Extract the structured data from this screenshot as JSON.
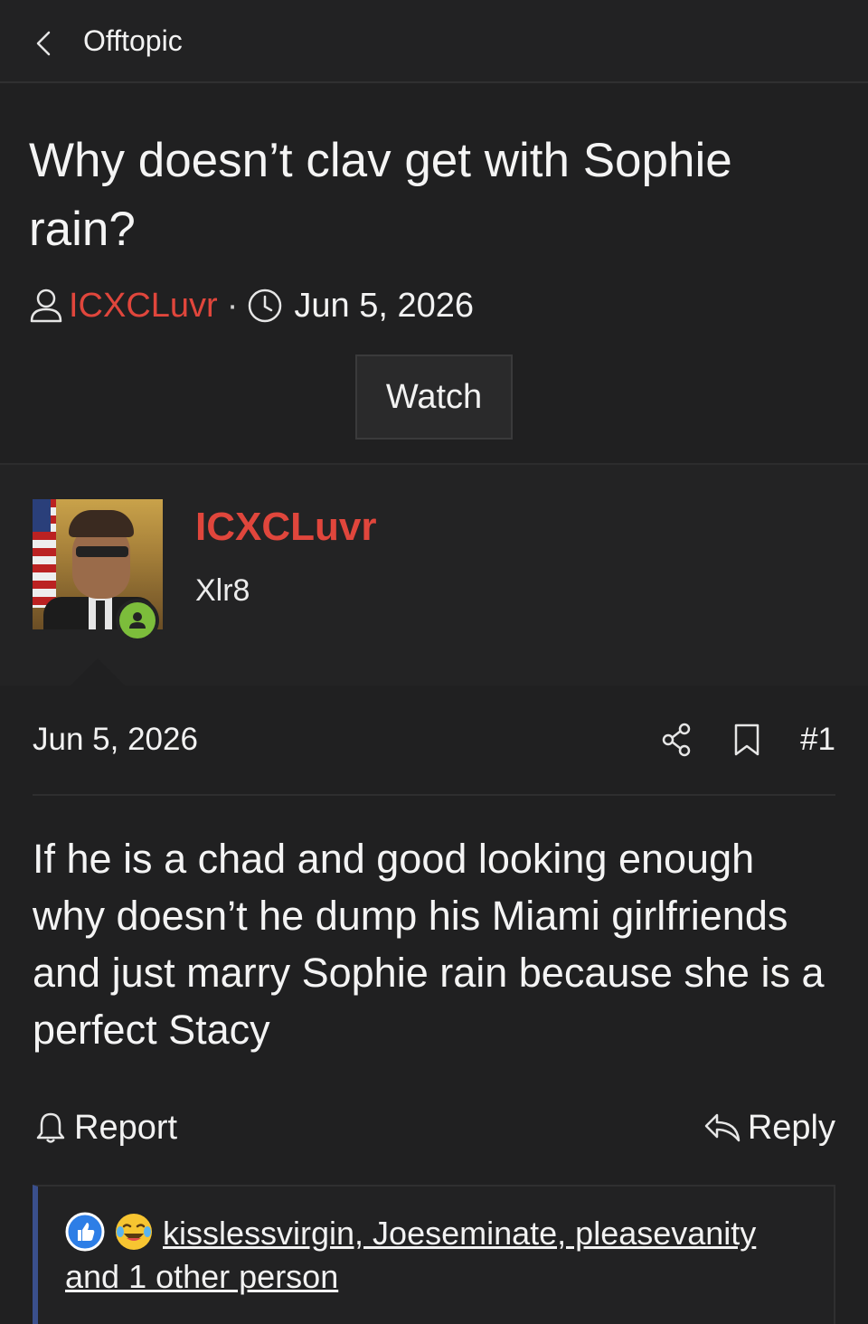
{
  "nav": {
    "forum_name": "Offtopic"
  },
  "thread": {
    "title": "Why doesn’t clav get with Sophie rain?",
    "author": "ICXCLuvr",
    "separator": "·",
    "date": "Jun 5, 2026",
    "watch_label": "Watch"
  },
  "post": {
    "username": "ICXCLuvr",
    "user_title": "Xlr8",
    "date": "Jun 5, 2026",
    "number": "#1",
    "body": "If he is a chad and good looking enough why doesn’t he dump his Miami girlfriends and just marry Sophie rain because she is a perfect Stacy",
    "report_label": "Report",
    "reply_label": "Reply",
    "reactions_text": "kisslessvirgin, Joeseminate, pleasevanity and 1 other person",
    "reaction_icons": [
      "like-icon",
      "laugh-cry-icon"
    ]
  },
  "colors": {
    "accent": "#e0463c",
    "online": "#7cbd3b",
    "reaction_border": "#3a4f8c",
    "like": "#2d7ee6"
  }
}
